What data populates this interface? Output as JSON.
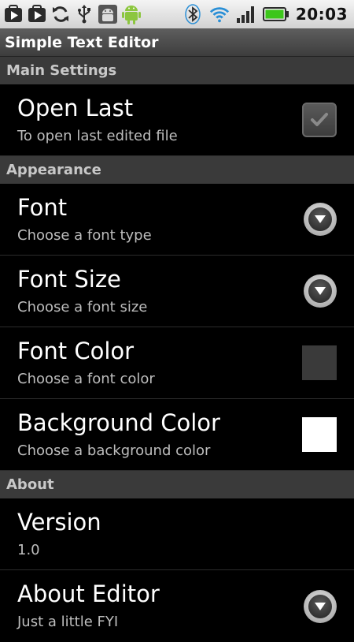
{
  "status_bar": {
    "icons": [
      "play-store-icon",
      "play-store-icon",
      "sync-icon",
      "usb-icon",
      "android-debug-icon",
      "android-icon",
      "bluetooth-icon",
      "wifi-icon",
      "signal-icon",
      "battery-icon"
    ],
    "time": "20:03"
  },
  "app": {
    "title": "Simple Text Editor"
  },
  "categories": {
    "main": "Main Settings",
    "appearance": "Appearance",
    "about": "About"
  },
  "prefs": {
    "open_last": {
      "title": "Open Last",
      "summary": "To open last edited file",
      "checked": true
    },
    "font": {
      "title": "Font",
      "summary": "Choose a font type"
    },
    "font_size": {
      "title": "Font Size",
      "summary": "Choose a font size"
    },
    "font_color": {
      "title": "Font Color",
      "summary": "Choose a font color",
      "color": "#3a3a3a"
    },
    "background_color": {
      "title": "Background Color",
      "summary": "Choose a background color",
      "color": "#ffffff"
    },
    "version": {
      "title": "Version",
      "summary": "1.0"
    },
    "about_editor": {
      "title": "About Editor",
      "summary": "Just a little FYI"
    }
  },
  "colors": {
    "status_bar_bg": "#e0e0e0",
    "title_bar_bg": "#4a4a4a",
    "category_bg": "#3a3a3a",
    "list_bg": "#000000",
    "battery_green": "#3cc61a",
    "wifi_blue": "#2a8fd6"
  }
}
